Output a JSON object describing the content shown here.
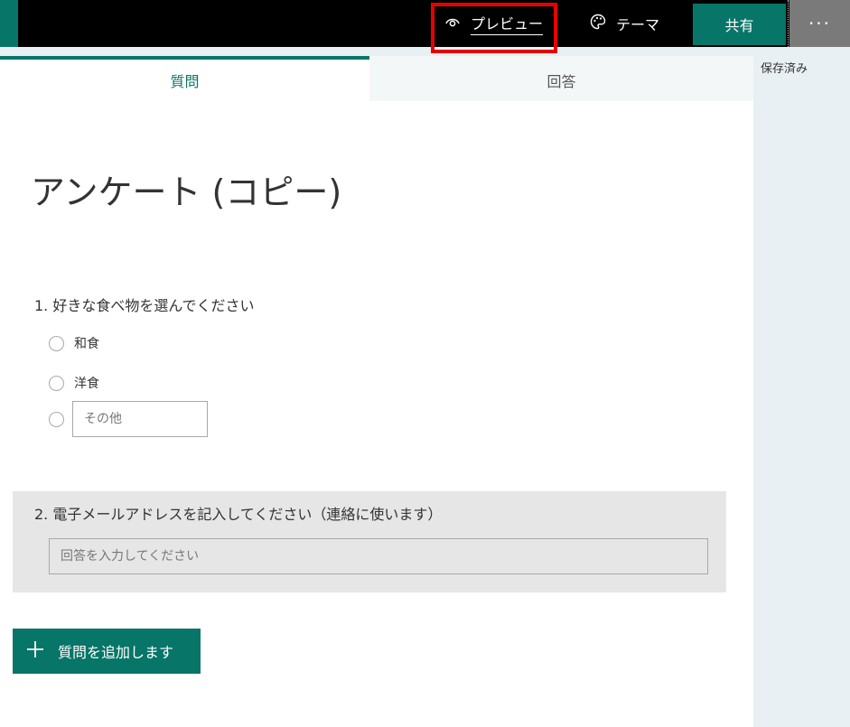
{
  "topbar": {
    "preview_label": "プレビュー",
    "preview_icon": "eye-icon",
    "theme_label": "テーマ",
    "theme_icon": "palette-icon",
    "share_label": "共有",
    "more_label": "···",
    "brand_color": "#077568",
    "highlight_color": "#e80000"
  },
  "status": {
    "saved": "保存済み"
  },
  "tabs": [
    {
      "label": "質問",
      "active": true
    },
    {
      "label": "回答",
      "active": false
    }
  ],
  "form": {
    "title": "アンケート (コピー)",
    "questions": [
      {
        "title": "1. 好きな食べ物を選んでください",
        "type": "choice",
        "options": [
          "和食",
          "洋食"
        ],
        "other_placeholder": "その他"
      },
      {
        "title": "2. 電子メールアドレスを記入してください（連絡に使います）",
        "type": "text",
        "placeholder": "回答を入力してください"
      }
    ],
    "add_question_label": "質問を追加します",
    "add_icon": "plus-icon"
  }
}
